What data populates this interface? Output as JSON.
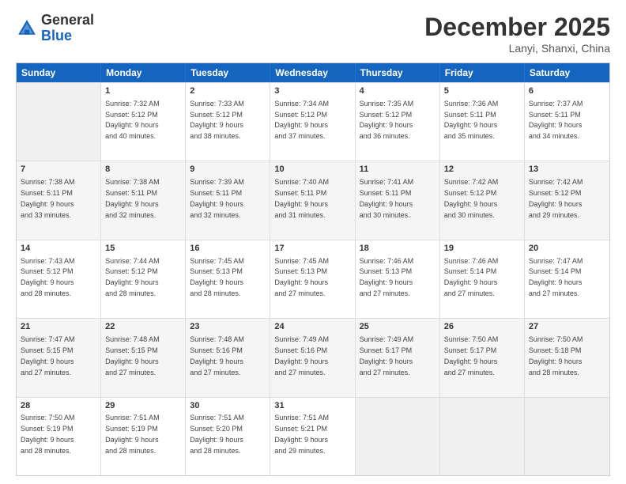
{
  "logo": {
    "general": "General",
    "blue": "Blue"
  },
  "title": "December 2025",
  "location": "Lanyi, Shanxi, China",
  "days": [
    "Sunday",
    "Monday",
    "Tuesday",
    "Wednesday",
    "Thursday",
    "Friday",
    "Saturday"
  ],
  "weeks": [
    [
      {
        "day": null
      },
      {
        "day": "1",
        "sunrise": "7:32 AM",
        "sunset": "5:12 PM",
        "daylight": "9 hours and 40 minutes."
      },
      {
        "day": "2",
        "sunrise": "7:33 AM",
        "sunset": "5:12 PM",
        "daylight": "9 hours and 38 minutes."
      },
      {
        "day": "3",
        "sunrise": "7:34 AM",
        "sunset": "5:12 PM",
        "daylight": "9 hours and 37 minutes."
      },
      {
        "day": "4",
        "sunrise": "7:35 AM",
        "sunset": "5:12 PM",
        "daylight": "9 hours and 36 minutes."
      },
      {
        "day": "5",
        "sunrise": "7:36 AM",
        "sunset": "5:11 PM",
        "daylight": "9 hours and 35 minutes."
      },
      {
        "day": "6",
        "sunrise": "7:37 AM",
        "sunset": "5:11 PM",
        "daylight": "9 hours and 34 minutes."
      }
    ],
    [
      {
        "day": "7",
        "sunrise": "7:38 AM",
        "sunset": "5:11 PM",
        "daylight": "9 hours and 33 minutes."
      },
      {
        "day": "8",
        "sunrise": "7:38 AM",
        "sunset": "5:11 PM",
        "daylight": "9 hours and 32 minutes."
      },
      {
        "day": "9",
        "sunrise": "7:39 AM",
        "sunset": "5:11 PM",
        "daylight": "9 hours and 32 minutes."
      },
      {
        "day": "10",
        "sunrise": "7:40 AM",
        "sunset": "5:11 PM",
        "daylight": "9 hours and 31 minutes."
      },
      {
        "day": "11",
        "sunrise": "7:41 AM",
        "sunset": "5:11 PM",
        "daylight": "9 hours and 30 minutes."
      },
      {
        "day": "12",
        "sunrise": "7:42 AM",
        "sunset": "5:12 PM",
        "daylight": "9 hours and 30 minutes."
      },
      {
        "day": "13",
        "sunrise": "7:42 AM",
        "sunset": "5:12 PM",
        "daylight": "9 hours and 29 minutes."
      }
    ],
    [
      {
        "day": "14",
        "sunrise": "7:43 AM",
        "sunset": "5:12 PM",
        "daylight": "9 hours and 28 minutes."
      },
      {
        "day": "15",
        "sunrise": "7:44 AM",
        "sunset": "5:12 PM",
        "daylight": "9 hours and 28 minutes."
      },
      {
        "day": "16",
        "sunrise": "7:45 AM",
        "sunset": "5:13 PM",
        "daylight": "9 hours and 28 minutes."
      },
      {
        "day": "17",
        "sunrise": "7:45 AM",
        "sunset": "5:13 PM",
        "daylight": "9 hours and 27 minutes."
      },
      {
        "day": "18",
        "sunrise": "7:46 AM",
        "sunset": "5:13 PM",
        "daylight": "9 hours and 27 minutes."
      },
      {
        "day": "19",
        "sunrise": "7:46 AM",
        "sunset": "5:14 PM",
        "daylight": "9 hours and 27 minutes."
      },
      {
        "day": "20",
        "sunrise": "7:47 AM",
        "sunset": "5:14 PM",
        "daylight": "9 hours and 27 minutes."
      }
    ],
    [
      {
        "day": "21",
        "sunrise": "7:47 AM",
        "sunset": "5:15 PM",
        "daylight": "9 hours and 27 minutes."
      },
      {
        "day": "22",
        "sunrise": "7:48 AM",
        "sunset": "5:15 PM",
        "daylight": "9 hours and 27 minutes."
      },
      {
        "day": "23",
        "sunrise": "7:48 AM",
        "sunset": "5:16 PM",
        "daylight": "9 hours and 27 minutes."
      },
      {
        "day": "24",
        "sunrise": "7:49 AM",
        "sunset": "5:16 PM",
        "daylight": "9 hours and 27 minutes."
      },
      {
        "day": "25",
        "sunrise": "7:49 AM",
        "sunset": "5:17 PM",
        "daylight": "9 hours and 27 minutes."
      },
      {
        "day": "26",
        "sunrise": "7:50 AM",
        "sunset": "5:17 PM",
        "daylight": "9 hours and 27 minutes."
      },
      {
        "day": "27",
        "sunrise": "7:50 AM",
        "sunset": "5:18 PM",
        "daylight": "9 hours and 28 minutes."
      }
    ],
    [
      {
        "day": "28",
        "sunrise": "7:50 AM",
        "sunset": "5:19 PM",
        "daylight": "9 hours and 28 minutes."
      },
      {
        "day": "29",
        "sunrise": "7:51 AM",
        "sunset": "5:19 PM",
        "daylight": "9 hours and 28 minutes."
      },
      {
        "day": "30",
        "sunrise": "7:51 AM",
        "sunset": "5:20 PM",
        "daylight": "9 hours and 28 minutes."
      },
      {
        "day": "31",
        "sunrise": "7:51 AM",
        "sunset": "5:21 PM",
        "daylight": "9 hours and 29 minutes."
      },
      {
        "day": null
      },
      {
        "day": null
      },
      {
        "day": null
      }
    ]
  ]
}
